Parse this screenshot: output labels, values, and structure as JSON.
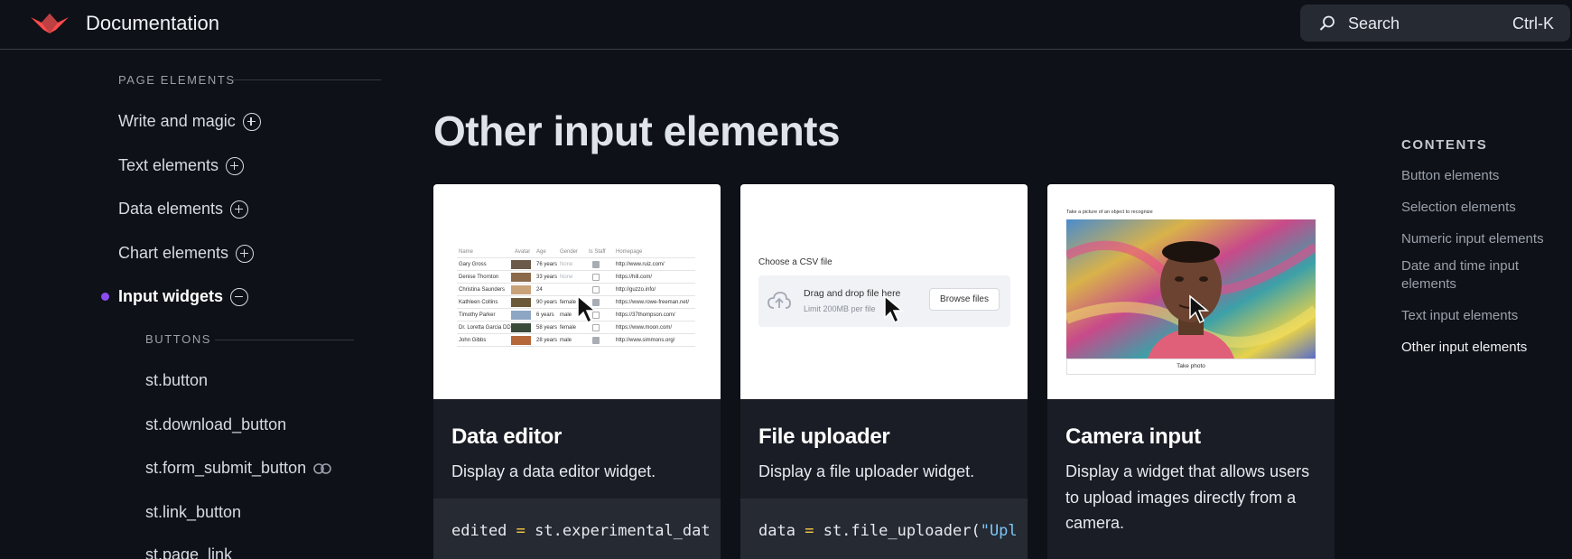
{
  "header": {
    "brand": "Documentation",
    "search": {
      "label": "Search",
      "shortcut": "Ctrl-K"
    },
    "logo_color": "#ff4b4b"
  },
  "sidebar": {
    "section_label": "PAGE ELEMENTS",
    "items": [
      {
        "label": "Write and magic",
        "icon": "plus-circle-icon"
      },
      {
        "label": "Text elements",
        "icon": "plus-circle-icon"
      },
      {
        "label": "Data elements",
        "icon": "plus-circle-icon"
      },
      {
        "label": "Chart elements",
        "icon": "plus-circle-icon"
      },
      {
        "label": "Input widgets",
        "icon": "minus-circle-icon",
        "active": true
      }
    ],
    "subsection_label": "BUTTONS",
    "sub_items": [
      {
        "label": "st.button"
      },
      {
        "label": "st.download_button"
      },
      {
        "label": "st.form_submit_button",
        "icon": "link-icon"
      },
      {
        "label": "st.link_button"
      },
      {
        "label": "st.page_link"
      }
    ],
    "active_dot_color": "#8a4cf0"
  },
  "main": {
    "title": "Other input elements",
    "cards": [
      {
        "title": "Data editor",
        "description": "Display a data editor widget.",
        "code": {
          "var": "edited",
          "op": "=",
          "rest": "st.experimental_dat"
        },
        "preview": {
          "headers": [
            "Name",
            "Avatar",
            "Age",
            "Gender",
            "Is Staff",
            "Homepage"
          ],
          "rows": [
            {
              "name": "Gary Gross",
              "age": "76 years",
              "gender": "None",
              "staff": true,
              "url": "http://www.ruiz.com/"
            },
            {
              "name": "Denise Thornton",
              "age": "33 years",
              "gender": "None",
              "staff": false,
              "url": "https://hill.com/"
            },
            {
              "name": "Christina Saunders",
              "age": "24",
              "gender": "",
              "staff": false,
              "url": "http://guzzo.info/"
            },
            {
              "name": "Kathleen Collins",
              "age": "90 years",
              "gender": "female",
              "staff": true,
              "url": "https://www.rowe-freeman.net/"
            },
            {
              "name": "Timothy Parker",
              "age": "6 years",
              "gender": "male",
              "staff": false,
              "url": "https://37thompson.com/"
            },
            {
              "name": "Dr. Loretta Garcia DDS",
              "age": "58 years",
              "gender": "female",
              "staff": false,
              "url": "https://www.moon.com/"
            },
            {
              "name": "John Gibbs",
              "age": "28 years",
              "gender": "male",
              "staff": true,
              "url": "http://www.simmons.org/"
            }
          ]
        }
      },
      {
        "title": "File uploader",
        "description": "Display a file uploader widget.",
        "code": {
          "var": "data",
          "op": "=",
          "rest": "st.file_uploader(",
          "str": "\"Upl"
        },
        "preview": {
          "label": "Choose a CSV file",
          "drop_text": "Drag and drop file here",
          "limit_text": "Limit 200MB per file",
          "button": "Browse files"
        }
      },
      {
        "title": "Camera input",
        "description": "Display a widget that allows users to upload images directly from a camera.",
        "preview": {
          "label": "Take a picture of an object to recognize",
          "button": "Take photo"
        }
      }
    ]
  },
  "toc": {
    "title": "CONTENTS",
    "items": [
      {
        "label": "Button elements"
      },
      {
        "label": "Selection elements"
      },
      {
        "label": "Numeric input elements"
      },
      {
        "label": "Date and time input elements"
      },
      {
        "label": "Text input elements"
      },
      {
        "label": "Other input elements",
        "active": true
      }
    ]
  }
}
